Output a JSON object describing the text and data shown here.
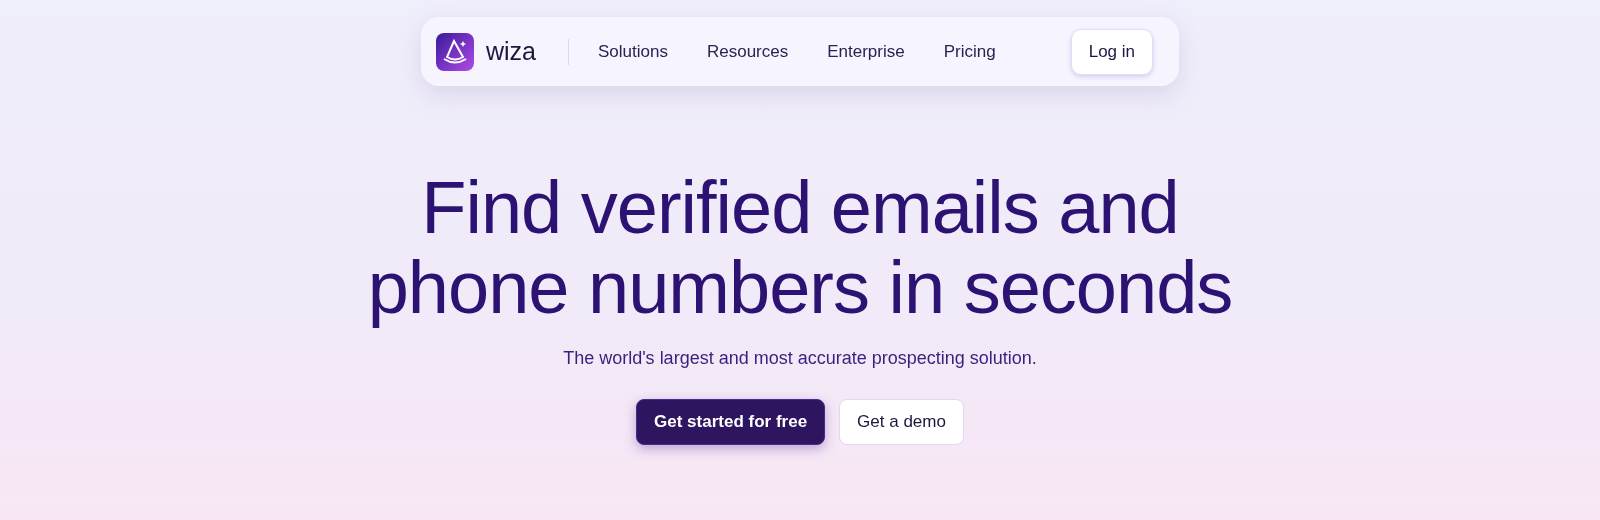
{
  "nav": {
    "brand": "wiza",
    "links": [
      "Solutions",
      "Resources",
      "Enterprise",
      "Pricing"
    ],
    "login": "Log in"
  },
  "hero": {
    "title_lines": [
      "Find verified emails and",
      "phone numbers in seconds"
    ],
    "subtitle": "The world's largest and most accurate prospecting solution.",
    "primary_button": "Get started for free",
    "secondary_button": "Get a demo"
  }
}
